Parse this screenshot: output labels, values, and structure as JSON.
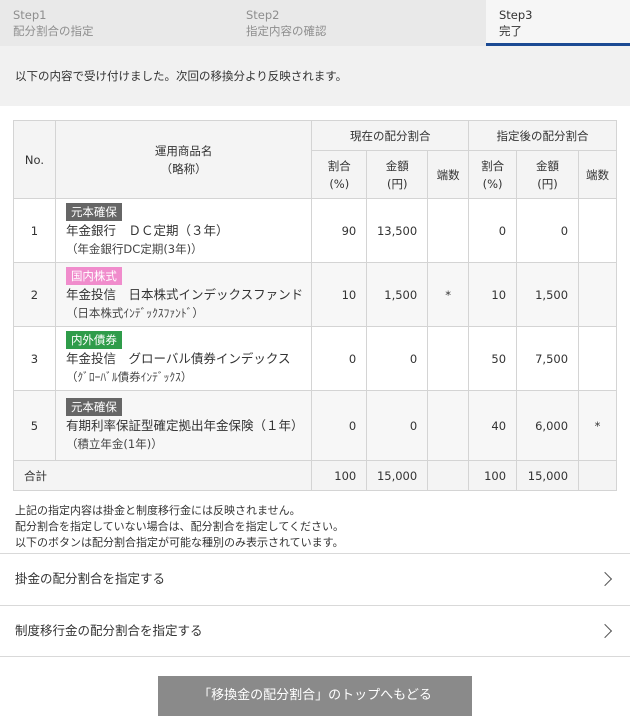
{
  "steps": [
    {
      "num": "Step1",
      "label": "配分割合の指定"
    },
    {
      "num": "Step2",
      "label": "指定内容の確認"
    },
    {
      "num": "Step3",
      "label": "完了"
    }
  ],
  "message": "以下の内容で受け付けました。次回の移換分より反映されます。",
  "table": {
    "headers": {
      "no": "No.",
      "product_l1": "運用商品名",
      "product_l2": "（略称）",
      "current": "現在の配分割合",
      "after": "指定後の配分割合",
      "ratio_l1": "割合",
      "ratio_l2": "(%)",
      "amount_l1": "金額",
      "amount_l2": "(円)",
      "fraction": "端数"
    },
    "rows": [
      {
        "no": "1",
        "badge": "元本確保",
        "name": "年金銀行　ＤＣ定期（３年）",
        "short": "（年金銀行DC定期(3年)）",
        "cur_ratio": "90",
        "cur_amount": "13,500",
        "cur_frac": "",
        "new_ratio": "0",
        "new_amount": "0",
        "new_frac": ""
      },
      {
        "no": "2",
        "badge": "国内株式",
        "name": "年金投信　日本株式インデックスファンド",
        "short": "（日本株式ｲﾝﾃﾞｯｸｽﾌｧﾝﾄﾞ）",
        "cur_ratio": "10",
        "cur_amount": "1,500",
        "cur_frac": "*",
        "new_ratio": "10",
        "new_amount": "1,500",
        "new_frac": ""
      },
      {
        "no": "3",
        "badge": "内外債券",
        "name": "年金投信　グローバル債券インデックス",
        "short": "（ｸﾞﾛｰﾊﾞﾙ債券ｲﾝﾃﾞｯｸｽ）",
        "cur_ratio": "0",
        "cur_amount": "0",
        "cur_frac": "",
        "new_ratio": "50",
        "new_amount": "7,500",
        "new_frac": ""
      },
      {
        "no": "5",
        "badge": "元本確保",
        "name": "有期利率保証型確定拠出年金保険（１年）",
        "short": "（積立年金(1年)）",
        "cur_ratio": "0",
        "cur_amount": "0",
        "cur_frac": "",
        "new_ratio": "40",
        "new_amount": "6,000",
        "new_frac": "*"
      }
    ],
    "total": {
      "label": "合計",
      "cur_ratio": "100",
      "cur_amount": "15,000",
      "new_ratio": "100",
      "new_amount": "15,000"
    }
  },
  "notes": [
    "上記の指定内容は掛金と制度移行金には反映されません。",
    "配分割合を指定していない場合は、配分割合を指定してください。",
    "以下のボタンは配分割合指定が可能な種別のみ表示されています。"
  ],
  "links": [
    {
      "label": "掛金の配分割合を指定する"
    },
    {
      "label": "制度移行金の配分割合を指定する"
    }
  ],
  "back_button": "「移換金の配分割合」のトップへもどる",
  "colors": {
    "accent": "#1b4a93",
    "badge_gray": "#666666",
    "badge_pink": "#f08ccc",
    "badge_green": "#2f9c4a"
  }
}
